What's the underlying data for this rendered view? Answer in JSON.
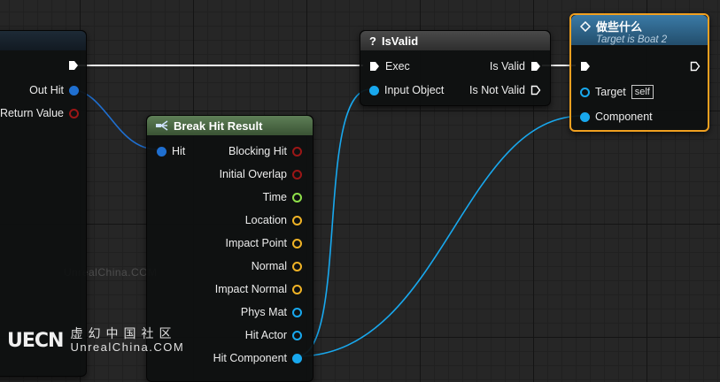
{
  "colors": {
    "exec": "#ffffff",
    "struct": "#1f6fd0",
    "object": "#18a8ee",
    "bool": "#9b1616",
    "float": "#8fe04a",
    "vector": "#f0b326",
    "selected_border": "#f0a020",
    "break_header": "#4a6a44",
    "isvalid_header": "#3a3a3a",
    "function_header": "#2c5f80"
  },
  "left_node": {
    "pins": [
      {
        "label": "Out Hit",
        "type": "struct"
      },
      {
        "label": "Return Value",
        "type": "bool"
      }
    ]
  },
  "break_hit_result": {
    "title": "Break Hit Result",
    "icon": "break-struct-icon",
    "input": {
      "label": "Hit",
      "type": "struct"
    },
    "outputs": [
      {
        "label": "Blocking Hit",
        "type": "bool"
      },
      {
        "label": "Initial Overlap",
        "type": "bool"
      },
      {
        "label": "Time",
        "type": "float"
      },
      {
        "label": "Location",
        "type": "vector"
      },
      {
        "label": "Impact Point",
        "type": "vector"
      },
      {
        "label": "Normal",
        "type": "vector"
      },
      {
        "label": "Impact Normal",
        "type": "vector"
      },
      {
        "label": "Phys Mat",
        "type": "object"
      },
      {
        "label": "Hit Actor",
        "type": "object"
      },
      {
        "label": "Hit Component",
        "type": "object"
      }
    ]
  },
  "is_valid": {
    "title": "IsValid",
    "icon": "question-mark-icon",
    "icon_text": "?",
    "exec_in": "Exec",
    "input_object": "Input Object",
    "is_valid_out": "Is Valid",
    "is_not_valid_out": "Is Not Valid"
  },
  "do_something": {
    "title": "做些什么",
    "subtitle": "Target is Boat 2",
    "icon": "function-icon",
    "target_label": "Target",
    "target_value": "self",
    "component_label": "Component"
  },
  "watermark": {
    "logo_mark": "UECN",
    "cn": "虚幻中国社区",
    "en": "UnrealChina.COM",
    "faint": "UnrealChina.COM"
  }
}
